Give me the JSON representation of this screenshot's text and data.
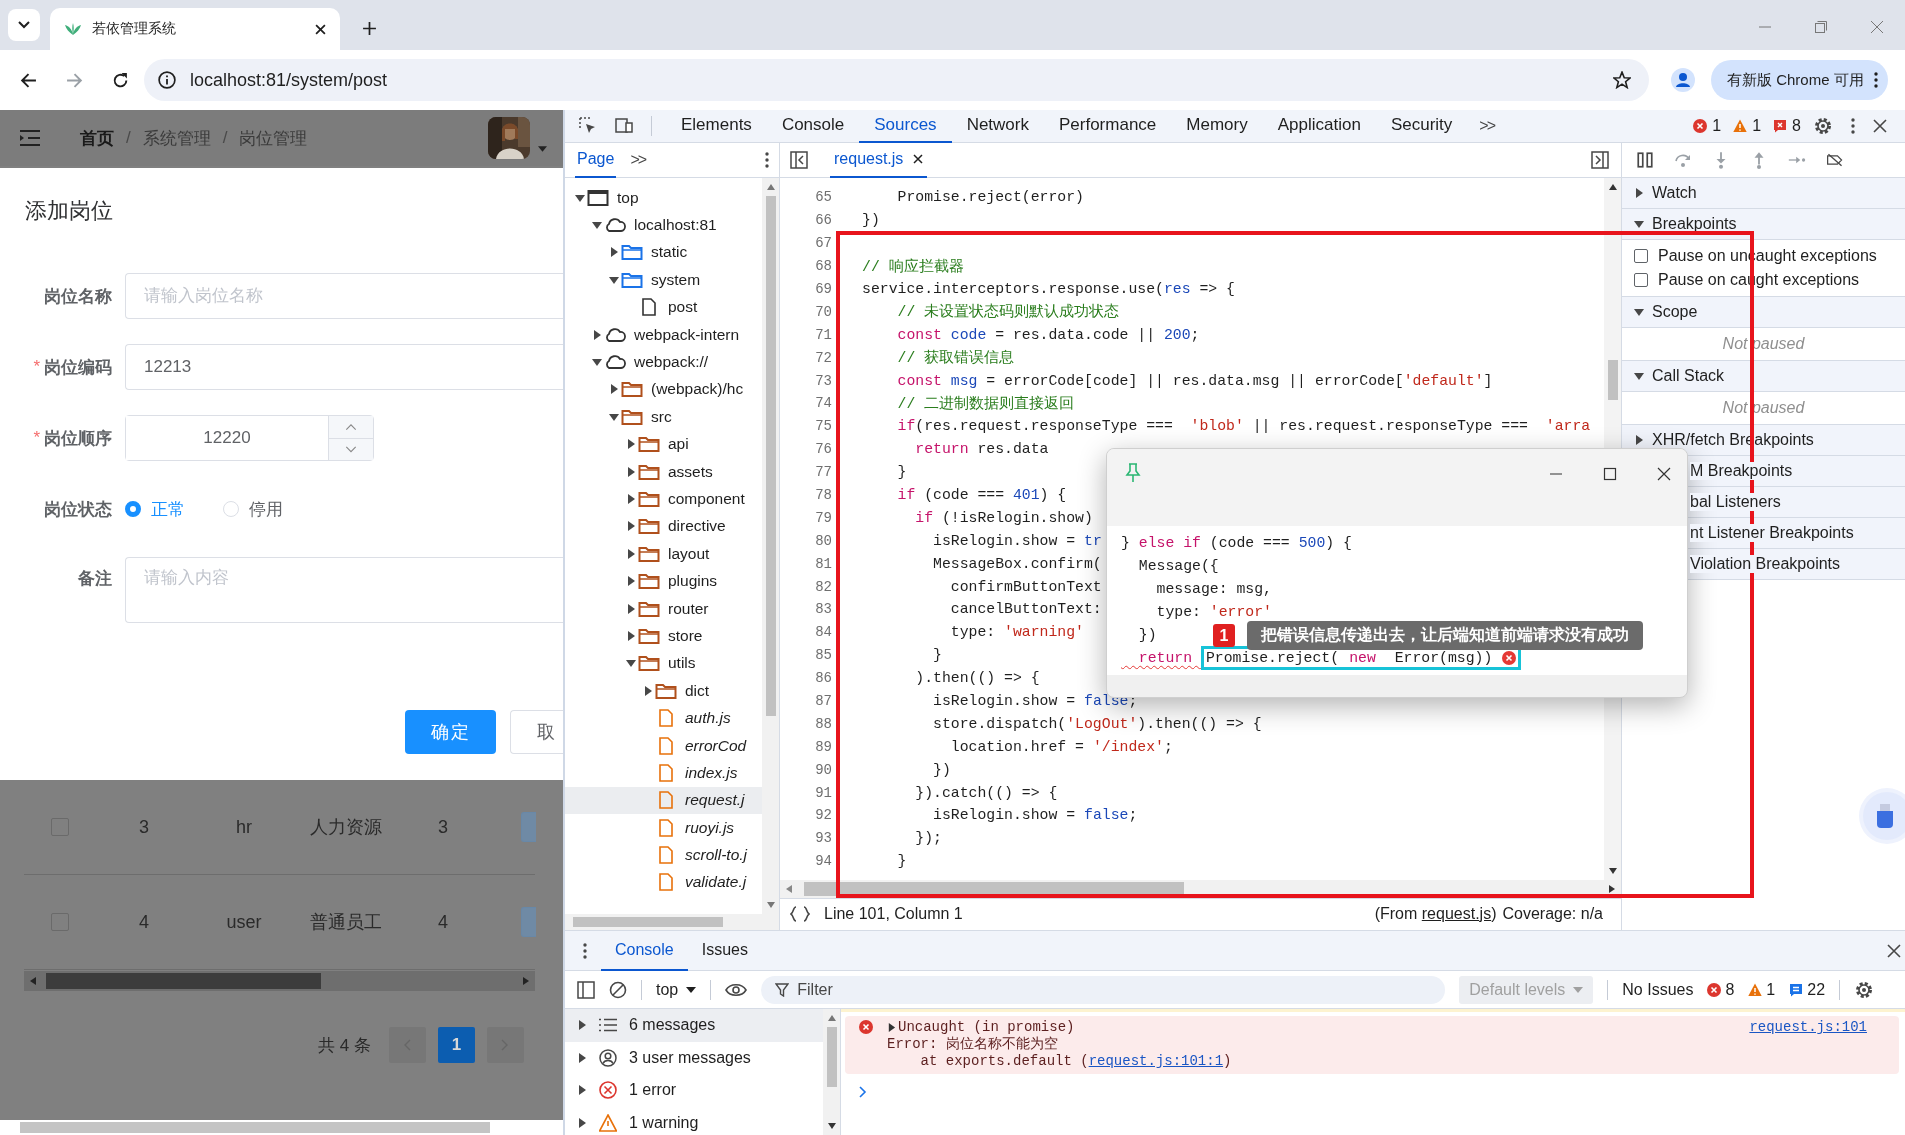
{
  "browser": {
    "tab_title": "若依管理系统",
    "address": "localhost:81/system/post",
    "update_label": "有新版 Chrome 可用"
  },
  "app": {
    "breadcrumb": [
      {
        "kind": "link",
        "label": "首页"
      },
      {
        "kind": "separator",
        "label": "/"
      },
      {
        "kind": "current",
        "label": "系统管理"
      },
      {
        "kind": "separator",
        "label": "/"
      },
      {
        "kind": "current",
        "label": "岗位管理"
      }
    ],
    "dialog": {
      "title": "添加岗位",
      "fields": [
        {
          "kind": "text",
          "label": "岗位名称",
          "placeholder": "请输入岗位名称"
        },
        {
          "kind": "text",
          "label": "岗位编码",
          "required_mark": "*",
          "value": "12213"
        },
        {
          "kind": "number",
          "label": "岗位顺序",
          "required_mark": "*",
          "value": "12220"
        },
        {
          "kind": "radio",
          "label": "岗位状态",
          "options": [
            {
              "label": "正常",
              "selected": true
            },
            {
              "label": "停用",
              "selected": false
            }
          ]
        },
        {
          "kind": "textarea",
          "label": "备注",
          "placeholder": "请输入内容"
        }
      ],
      "buttons": [
        {
          "kind": "primary",
          "label": "确定"
        },
        {
          "kind": "default",
          "label": "取"
        }
      ]
    },
    "table_rows": [
      {
        "checked": false,
        "cells": [
          "3",
          "hr",
          "人力资源",
          "3"
        ]
      },
      {
        "checked": false,
        "cells": [
          "4",
          "user",
          "普通员工",
          "4"
        ]
      }
    ],
    "pagination": {
      "total": "共 4 条",
      "pages": [
        {
          "label": "1",
          "selected": true
        }
      ]
    }
  },
  "devtools": {
    "tabs": [
      {
        "label": "Elements",
        "selected": false
      },
      {
        "label": "Console",
        "selected": false
      },
      {
        "label": "Sources",
        "selected": true
      },
      {
        "label": "Network",
        "selected": false
      },
      {
        "label": "Performance",
        "selected": false
      },
      {
        "label": "Memory",
        "selected": false
      },
      {
        "label": "Application",
        "selected": false
      },
      {
        "label": "Security",
        "selected": false
      }
    ],
    "more": ">>",
    "counts": [
      {
        "kind": "error",
        "count": "1"
      },
      {
        "kind": "warning",
        "count": "1"
      },
      {
        "kind": "issue",
        "count": "8"
      }
    ],
    "navigator": {
      "tabs": [
        {
          "label": "Page",
          "selected": true
        }
      ],
      "more": ">>",
      "tree": [
        {
          "label": "top",
          "kind": "frame",
          "expanded": true,
          "selected": false,
          "children": [
            {
              "label": "localhost:81",
              "kind": "domain",
              "expanded": true,
              "selected": false,
              "children": [
                {
                  "label": "static",
                  "kind": "page-folder",
                  "expanded": false,
                  "selected": false
                },
                {
                  "label": "system",
                  "kind": "page-folder",
                  "expanded": true,
                  "selected": false,
                  "children": [
                    {
                      "label": "post",
                      "kind": "document",
                      "selected": false
                    }
                  ]
                }
              ]
            },
            {
              "label": "webpack-intern",
              "kind": "domain",
              "expanded": false,
              "selected": false
            },
            {
              "label": "webpack://",
              "kind": "domain",
              "expanded": true,
              "selected": false,
              "children": [
                {
                  "label": "(webpack)/hc",
                  "kind": "folder",
                  "expanded": false,
                  "selected": false
                },
                {
                  "label": "src",
                  "kind": "folder",
                  "expanded": true,
                  "selected": false,
                  "children": [
                    {
                      "label": "api",
                      "kind": "folder",
                      "expanded": false,
                      "selected": false
                    },
                    {
                      "label": "assets",
                      "kind": "folder",
                      "expanded": false,
                      "selected": false
                    },
                    {
                      "label": "component",
                      "kind": "folder",
                      "expanded": false,
                      "selected": false
                    },
                    {
                      "label": "directive",
                      "kind": "folder",
                      "expanded": false,
                      "selected": false
                    },
                    {
                      "label": "layout",
                      "kind": "folder",
                      "expanded": false,
                      "selected": false
                    },
                    {
                      "label": "plugins",
                      "kind": "folder",
                      "expanded": false,
                      "selected": false
                    },
                    {
                      "label": "router",
                      "kind": "folder",
                      "expanded": false,
                      "selected": false
                    },
                    {
                      "label": "store",
                      "kind": "folder",
                      "expanded": false,
                      "selected": false
                    },
                    {
                      "label": "utils",
                      "kind": "folder",
                      "expanded": true,
                      "selected": false,
                      "children": [
                        {
                          "label": "dict",
                          "kind": "folder",
                          "expanded": false,
                          "selected": false
                        },
                        {
                          "label": "auth.js",
                          "kind": "script",
                          "selected": false
                        },
                        {
                          "label": "errorCod",
                          "kind": "script",
                          "selected": false
                        },
                        {
                          "label": "index.js",
                          "kind": "script",
                          "selected": false
                        },
                        {
                          "label": "request.j",
                          "kind": "script",
                          "selected": true
                        },
                        {
                          "label": "ruoyi.js",
                          "kind": "script",
                          "selected": false
                        },
                        {
                          "label": "scroll-to.j",
                          "kind": "script",
                          "selected": false
                        },
                        {
                          "label": "validate.j",
                          "kind": "script",
                          "selected": false
                        }
                      ]
                    }
                  ]
                }
              ]
            }
          ]
        }
      ]
    },
    "editor": {
      "tabs": [
        {
          "label": "request.js",
          "selected": true
        }
      ],
      "lines": [
        {
          "number": "65",
          "tokens": [
            {
              "text": "    Promise.reject(error)",
              "kind": "plain"
            }
          ]
        },
        {
          "number": "66",
          "tokens": [
            {
              "text": "})",
              "kind": "plain"
            }
          ]
        },
        {
          "number": "67"
        },
        {
          "number": "68",
          "tokens": [
            {
              "text": "// 响应拦截器",
              "kind": "comment"
            }
          ]
        },
        {
          "number": "69",
          "tokens": [
            {
              "text": "service.interceptors.response.use(",
              "kind": "plain"
            },
            {
              "text": "res",
              "kind": "variable"
            },
            {
              "text": " => {",
              "kind": "plain"
            }
          ]
        },
        {
          "number": "70",
          "tokens": [
            {
              "text": "    // 未设置状态码则默认成功状态",
              "kind": "comment"
            }
          ]
        },
        {
          "number": "71",
          "tokens": [
            {
              "text": "    const",
              "kind": "keyword"
            },
            {
              "text": " code",
              "kind": "variable"
            },
            {
              "text": " = res.data.code || ",
              "kind": "plain"
            },
            {
              "text": "200",
              "kind": "variable"
            },
            {
              "text": ";",
              "kind": "plain"
            }
          ]
        },
        {
          "number": "72",
          "tokens": [
            {
              "text": "    // 获取错误信息",
              "kind": "comment"
            }
          ]
        },
        {
          "number": "73",
          "tokens": [
            {
              "text": "    const",
              "kind": "keyword"
            },
            {
              "text": " msg",
              "kind": "variable"
            },
            {
              "text": " = errorCode[code] || res.data.msg || errorCode[",
              "kind": "plain"
            },
            {
              "text": "'default'",
              "kind": "string"
            },
            {
              "text": "]",
              "kind": "plain"
            }
          ]
        },
        {
          "number": "74",
          "tokens": [
            {
              "text": "    // 二进制数据则直接返回",
              "kind": "comment"
            }
          ]
        },
        {
          "number": "75",
          "tokens": [
            {
              "text": "    if",
              "kind": "keyword"
            },
            {
              "text": "(res.request.responseType ===  ",
              "kind": "plain"
            },
            {
              "text": "'blob'",
              "kind": "string"
            },
            {
              "text": " || res.request.responseType ===  ",
              "kind": "plain"
            },
            {
              "text": "'arra",
              "kind": "string"
            }
          ]
        },
        {
          "number": "76",
          "tokens": [
            {
              "text": "      return",
              "kind": "keyword"
            },
            {
              "text": " res.data",
              "kind": "plain"
            }
          ]
        },
        {
          "number": "77",
          "tokens": [
            {
              "text": "    }",
              "kind": "plain"
            }
          ]
        },
        {
          "number": "78",
          "tokens": [
            {
              "text": "    if",
              "kind": "keyword"
            },
            {
              "text": " (code === ",
              "kind": "plain"
            },
            {
              "text": "401",
              "kind": "variable"
            },
            {
              "text": ") {",
              "kind": "plain"
            }
          ]
        },
        {
          "number": "79",
          "tokens": [
            {
              "text": "      if",
              "kind": "keyword"
            },
            {
              "text": " (!isRelogin.show)",
              "kind": "plain"
            }
          ]
        },
        {
          "number": "80",
          "tokens": [
            {
              "text": "        isRelogin.show = ",
              "kind": "plain"
            },
            {
              "text": "tr",
              "kind": "variable"
            }
          ]
        },
        {
          "number": "81",
          "tokens": [
            {
              "text": "        MessageBox.confirm(",
              "kind": "plain"
            }
          ]
        },
        {
          "number": "82",
          "tokens": [
            {
              "text": "          confirmButtonText",
              "kind": "plain"
            }
          ]
        },
        {
          "number": "83",
          "tokens": [
            {
              "text": "          cancelButtonText:",
              "kind": "plain"
            }
          ]
        },
        {
          "number": "84",
          "tokens": [
            {
              "text": "          type: ",
              "kind": "plain"
            },
            {
              "text": "'warning'",
              "kind": "string"
            }
          ]
        },
        {
          "number": "85",
          "tokens": [
            {
              "text": "        }",
              "kind": "plain"
            }
          ]
        },
        {
          "number": "86",
          "tokens": [
            {
              "text": "      ).then(() => {",
              "kind": "plain"
            }
          ]
        },
        {
          "number": "87",
          "tokens": [
            {
              "text": "        isRelogin.show = ",
              "kind": "plain"
            },
            {
              "text": "false",
              "kind": "variable"
            },
            {
              "text": ";",
              "kind": "plain"
            }
          ]
        },
        {
          "number": "88",
          "tokens": [
            {
              "text": "        store.dispatch(",
              "kind": "plain"
            },
            {
              "text": "'LogOut'",
              "kind": "string"
            },
            {
              "text": ").then(() => {",
              "kind": "plain"
            }
          ]
        },
        {
          "number": "89",
          "tokens": [
            {
              "text": "          location.href = ",
              "kind": "plain"
            },
            {
              "text": "'/index'",
              "kind": "string"
            },
            {
              "text": ";",
              "kind": "plain"
            }
          ]
        },
        {
          "number": "90",
          "tokens": [
            {
              "text": "        })",
              "kind": "plain"
            }
          ]
        },
        {
          "number": "91",
          "tokens": [
            {
              "text": "      }).catch(() => {",
              "kind": "plain"
            }
          ]
        },
        {
          "number": "92",
          "tokens": [
            {
              "text": "        isRelogin.show = ",
              "kind": "plain"
            },
            {
              "text": "false",
              "kind": "variable"
            },
            {
              "text": ";",
              "kind": "plain"
            }
          ]
        },
        {
          "number": "93",
          "tokens": [
            {
              "text": "      });",
              "kind": "plain"
            }
          ]
        },
        {
          "number": "94",
          "tokens": [
            {
              "text": "    }",
              "kind": "plain"
            }
          ]
        }
      ],
      "status": {
        "cursor": "Line 101, Column 1",
        "source_prefix": "(From ",
        "source_link": "request.js",
        "source_suffix": ")",
        "coverage": "Coverage: n/a"
      }
    },
    "sidebar": {
      "sections": [
        {
          "label": "Watch",
          "expanded": false
        },
        {
          "label": "Breakpoints",
          "expanded": true,
          "options": [
            {
              "label": "Pause on uncaught exceptions",
              "checked": false
            },
            {
              "label": "Pause on caught exceptions",
              "checked": false
            }
          ]
        },
        {
          "label": "Scope",
          "expanded": true,
          "note": "Not paused"
        },
        {
          "label": "Call Stack",
          "expanded": true,
          "note": "Not paused"
        },
        {
          "label": "XHR/fetch Breakpoints",
          "expanded": false
        },
        {
          "label": "M Breakpoints",
          "covered": true
        },
        {
          "label": "bal Listeners",
          "covered": true
        },
        {
          "label": "nt Listener Breakpoints",
          "covered": true
        },
        {
          "label": "Violation Breakpoints",
          "covered": true
        }
      ]
    },
    "floating_window": {
      "lines": [
        {
          "tokens": [
            {
              "text": "} ",
              "kind": "plain"
            },
            {
              "text": "else if",
              "kind": "keyword"
            },
            {
              "text": " (code === ",
              "kind": "plain"
            },
            {
              "text": "500",
              "kind": "variable"
            },
            {
              "text": ") {",
              "kind": "plain"
            }
          ]
        },
        {
          "tokens": [
            {
              "text": "  Message({",
              "kind": "plain"
            }
          ]
        },
        {
          "tokens": [
            {
              "text": "    message: msg,",
              "kind": "plain"
            }
          ]
        },
        {
          "tokens": [
            {
              "text": "    type: ",
              "kind": "plain"
            },
            {
              "text": "'error'",
              "kind": "string"
            }
          ]
        },
        {
          "tokens": [
            {
              "text": "  })",
              "kind": "plain"
            }
          ]
        }
      ],
      "error_line": {
        "has_error": true,
        "tokens": [
          {
            "text": "  return ",
            "kind": "keyword"
          }
        ],
        "highlight": [
          {
            "text": "Promise.reject(",
            "kind": "plain"
          },
          {
            "text": "new",
            "kind": "keyword"
          },
          {
            "text": " Error(msg))",
            "kind": "plain"
          }
        ]
      },
      "callout": {
        "number": "1",
        "text": "把错误信息传递出去，让后端知道前端请求没有成功"
      }
    },
    "drawer": {
      "tabs": [
        {
          "label": "Console",
          "selected": true
        },
        {
          "label": "Issues",
          "selected": false
        }
      ],
      "context": "top",
      "filter_placeholder": "Filter",
      "levels": "Default levels",
      "issues": "No Issues",
      "counts": [
        {
          "kind": "error",
          "count": "8"
        },
        {
          "kind": "warning",
          "count": "1"
        },
        {
          "kind": "info",
          "count": "22"
        }
      ],
      "groups": [
        {
          "kind": "messages",
          "label": "6 messages",
          "selected": true
        },
        {
          "kind": "user",
          "label": "3 user messages",
          "selected": false
        },
        {
          "kind": "error",
          "label": "1 error",
          "selected": false
        },
        {
          "kind": "warning",
          "label": "1 warning",
          "selected": false
        }
      ],
      "messages": [
        {
          "kind": "error",
          "summary": "Uncaught (in promise)",
          "source": "request.js:101",
          "detail": "Error: 岗位名称不能为空",
          "trace_prefix": "    at exports.default (",
          "trace_link": "request.js:101:1",
          "trace_suffix": ")"
        }
      ]
    }
  }
}
